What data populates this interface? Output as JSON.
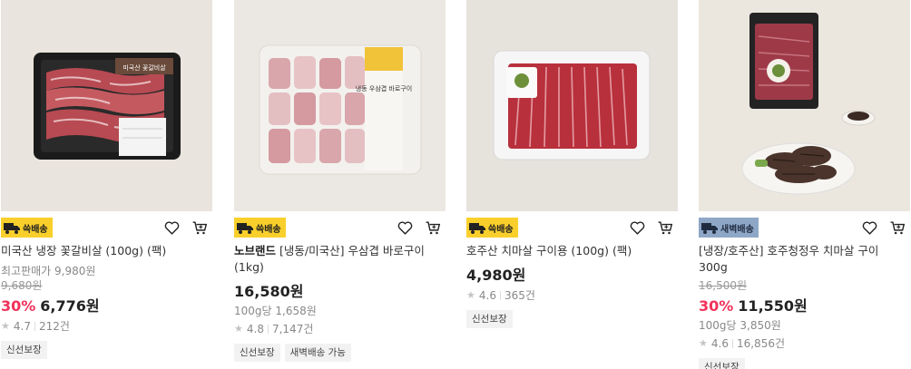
{
  "colors": {
    "fast_badge": "#f9cf2b",
    "dawn_badge": "#8fa7c7",
    "discount": "#f2315a"
  },
  "products": [
    {
      "badge": "쓱배송",
      "title": "미국산 냉장 꽃갈비살 (100g) (팩)",
      "brand": "",
      "subtext": "최고판매가 9,980원",
      "original_price": "9,680원",
      "discount": "30%",
      "price": "6,776원",
      "unit_price": "",
      "rating": "4.7",
      "reviews": "212건",
      "tags": [
        "신선보장"
      ],
      "pack_label": "미국산 꽃갈비살"
    },
    {
      "badge": "쓱배송",
      "title": "[냉동/미국산] 우삼겹 바로구이 (1kg)",
      "brand": "노브랜드",
      "subtext": "",
      "original_price": "",
      "discount": "",
      "price": "16,580원",
      "unit_price": "100g당 1,658원",
      "rating": "4.8",
      "reviews": "7,147건",
      "tags": [
        "신선보장",
        "새벽배송 가능"
      ],
      "pack_label": "냉동 우삼겹 바로구이"
    },
    {
      "badge": "쓱배송",
      "title": "호주산 치마살 구이용 (100g) (팩)",
      "brand": "",
      "subtext": "",
      "original_price": "",
      "discount": "",
      "price": "4,980원",
      "unit_price": "",
      "rating": "4.6",
      "reviews": "365건",
      "tags": [
        "신선보장"
      ],
      "pack_label": ""
    },
    {
      "badge": "새벽배송",
      "title": "[냉장/호주산] 호주청정우 치마살 구이 300g",
      "brand": "",
      "subtext": "",
      "original_price": "16,500원",
      "discount": "30%",
      "price": "11,550원",
      "unit_price": "100g당 3,850원",
      "rating": "4.6",
      "reviews": "16,856건",
      "tags": [
        "신선보장"
      ],
      "pack_label": ""
    }
  ]
}
